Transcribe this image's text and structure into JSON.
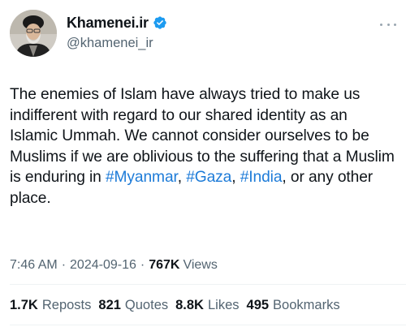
{
  "author": {
    "display_name": "Khamenei.ir",
    "handle": "@khamenei_ir",
    "verified": true
  },
  "tweet": {
    "text_segments": [
      {
        "text": "The enemies of Islam have always tried to make us indifferent with regard to our shared identity as an Islamic Ummah. We cannot consider ourselves to be Muslims if we are oblivious to the suffering that a Muslim is enduring in ",
        "type": "text"
      },
      {
        "text": "#Myanmar",
        "type": "hashtag"
      },
      {
        "text": ", ",
        "type": "text"
      },
      {
        "text": "#Gaza",
        "type": "hashtag"
      },
      {
        "text": ", ",
        "type": "text"
      },
      {
        "text": "#India",
        "type": "hashtag"
      },
      {
        "text": ", or any other place.",
        "type": "text"
      }
    ]
  },
  "meta": {
    "time": "7:46 AM",
    "separator": "·",
    "date": "2024-09-16",
    "views_count": "767K",
    "views_label": "Views"
  },
  "stats": {
    "reposts_count": "1.7K",
    "reposts_label": "Reposts",
    "quotes_count": "821",
    "quotes_label": "Quotes",
    "likes_count": "8.8K",
    "likes_label": "Likes",
    "bookmarks_count": "495",
    "bookmarks_label": "Bookmarks"
  },
  "colors": {
    "hashtag": "#1d7bd8",
    "verified_badge": "#1d9bf0",
    "secondary_text": "#536471",
    "primary_text": "#0f1419"
  },
  "icons": {
    "verified": "verified-badge-icon",
    "more": "more-options-icon"
  }
}
